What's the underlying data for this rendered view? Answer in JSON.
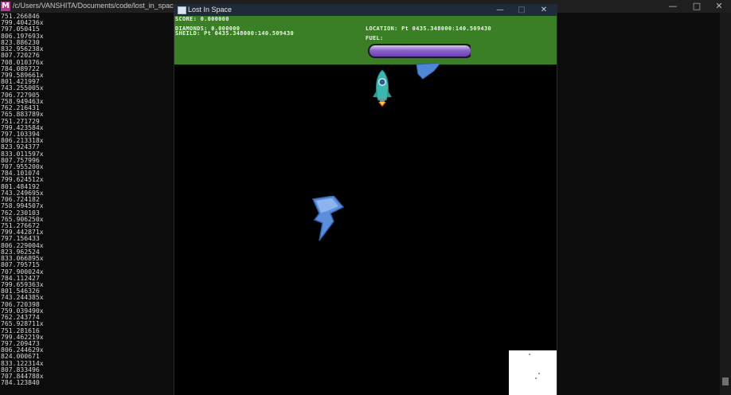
{
  "terminal": {
    "path": "/c/Users/VANSHITA/Documents/code/lost_in_space",
    "logo": "M",
    "controls": [
      "—",
      "□",
      "✕"
    ],
    "lines": [
      "751.266846",
      "799.404236x",
      "797.050415",
      "806.197693x",
      "823.886230",
      "832.956238x",
      "807.720276",
      "708.010376x",
      "784.089722",
      "799.589661x",
      "801.421997",
      "743.255005x",
      "706.727905",
      "758.949463x",
      "762.216431",
      "765.883789x",
      "751.271729",
      "799.423584x",
      "797.103394",
      "806.213318x",
      "823.924377",
      "833.011597x",
      "807.757996",
      "707.955200x",
      "784.101074",
      "799.624512x",
      "801.484192",
      "743.249695x",
      "706.724182",
      "758.994507x",
      "762.230103",
      "765.906250x",
      "751.276672",
      "799.442871x",
      "797.156433",
      "806.229004x",
      "823.962524",
      "833.066895x",
      "807.795715",
      "707.900024x",
      "784.112427",
      "799.659363x",
      "801.546326",
      "743.244385x",
      "706.720398",
      "759.039490x",
      "762.243774",
      "765.928711x",
      "751.281616",
      "799.462219x",
      "797.209473",
      "806.244629x",
      "824.000671",
      "833.122314x",
      "807.833496",
      "707.844788x",
      "784.123840"
    ]
  },
  "game": {
    "title": "Lost In Space",
    "controls": [
      "—",
      "□",
      "✕"
    ],
    "hud": {
      "score": "SCORE: 0.000000",
      "diamonds": "DIAMONDS: 0.000000",
      "sheild": "SHEILD: Pt 0435.348000:140.509430",
      "location": "LOCATION: Pt 0435.348000:140.509430",
      "fuel_label": "FUEL:",
      "fuel_level": 0.99
    },
    "colors": {
      "hud_bg": "#3a7e26",
      "fuel": "#8a63c9",
      "bolt": "#4f86d6",
      "space": "#000000"
    },
    "icons": [
      "rocket-icon",
      "lightning-bolt-icon"
    ]
  }
}
